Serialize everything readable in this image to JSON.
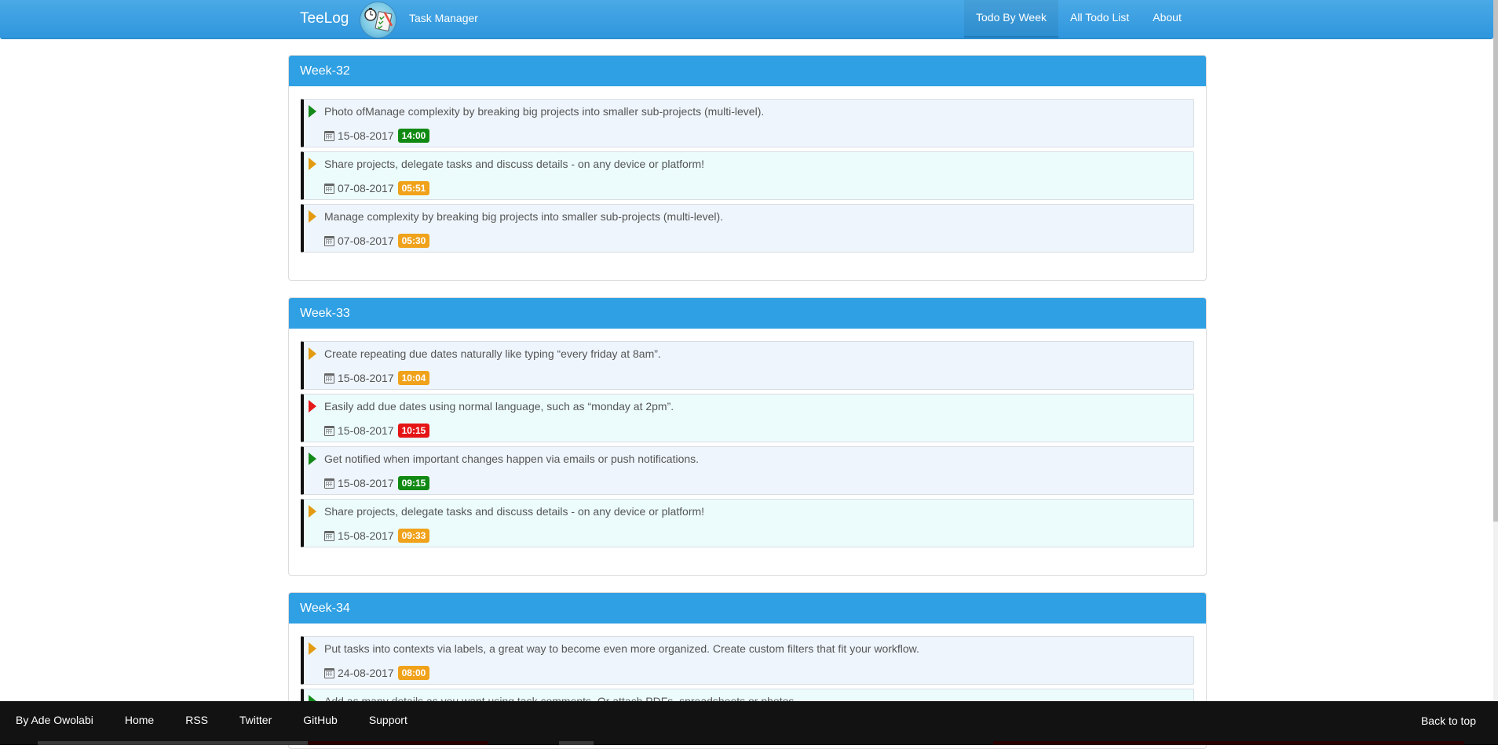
{
  "navbar": {
    "brand": "TeeLog",
    "subtitle": "Task Manager",
    "links": [
      {
        "label": "Todo By Week",
        "active": true
      },
      {
        "label": "All Todo List",
        "active": false
      },
      {
        "label": "About",
        "active": false
      }
    ]
  },
  "weeks": [
    {
      "title": "Week-32",
      "tasks": [
        {
          "text": "Photo ofManage complexity by breaking big projects into smaller sub-projects (multi-level).",
          "date": "15-08-2017",
          "time": "14:00",
          "status": "green"
        },
        {
          "text": "Share projects, delegate tasks and discuss details - on any device or platform!",
          "date": "07-08-2017",
          "time": "05:51",
          "status": "orange"
        },
        {
          "text": "Manage complexity by breaking big projects into smaller sub-projects (multi-level).",
          "date": "07-08-2017",
          "time": "05:30",
          "status": "orange"
        }
      ]
    },
    {
      "title": "Week-33",
      "tasks": [
        {
          "text": "Create repeating due dates naturally like typing “every friday at 8am”.",
          "date": "15-08-2017",
          "time": "10:04",
          "status": "orange"
        },
        {
          "text": "Easily add due dates using normal language, such as “monday at 2pm”.",
          "date": "15-08-2017",
          "time": "10:15",
          "status": "red"
        },
        {
          "text": "Get notified when important changes happen via emails or push notifications.",
          "date": "15-08-2017",
          "time": "09:15",
          "status": "green"
        },
        {
          "text": "Share projects, delegate tasks and discuss details - on any device or platform!",
          "date": "15-08-2017",
          "time": "09:33",
          "status": "orange"
        }
      ]
    },
    {
      "title": "Week-34",
      "tasks": [
        {
          "text": "Put tasks into contexts via labels, a great way to become even more organized. Create custom filters that fit your workflow.",
          "date": "24-08-2017",
          "time": "08:00",
          "status": "orange"
        },
        {
          "text": "Add as many details as you want using task comments. Or attach PDFs, spreadsheets or photos.",
          "date": "",
          "time": "",
          "status": "green"
        }
      ]
    }
  ],
  "footer": {
    "links": [
      "By Ade Owolabi",
      "Home",
      "RSS",
      "Twitter",
      "GitHub",
      "Support"
    ],
    "back_to_top": "Back to top"
  },
  "icons": {
    "calendar": "calendar-icon",
    "flag": "priority-flag-icon",
    "logo": "stopwatch-checklist-logo"
  },
  "colors": {
    "primary": "#2fa0e3",
    "green": "#118a14",
    "orange": "#f0a21a",
    "red": "#e51515",
    "footer": "#121212"
  }
}
